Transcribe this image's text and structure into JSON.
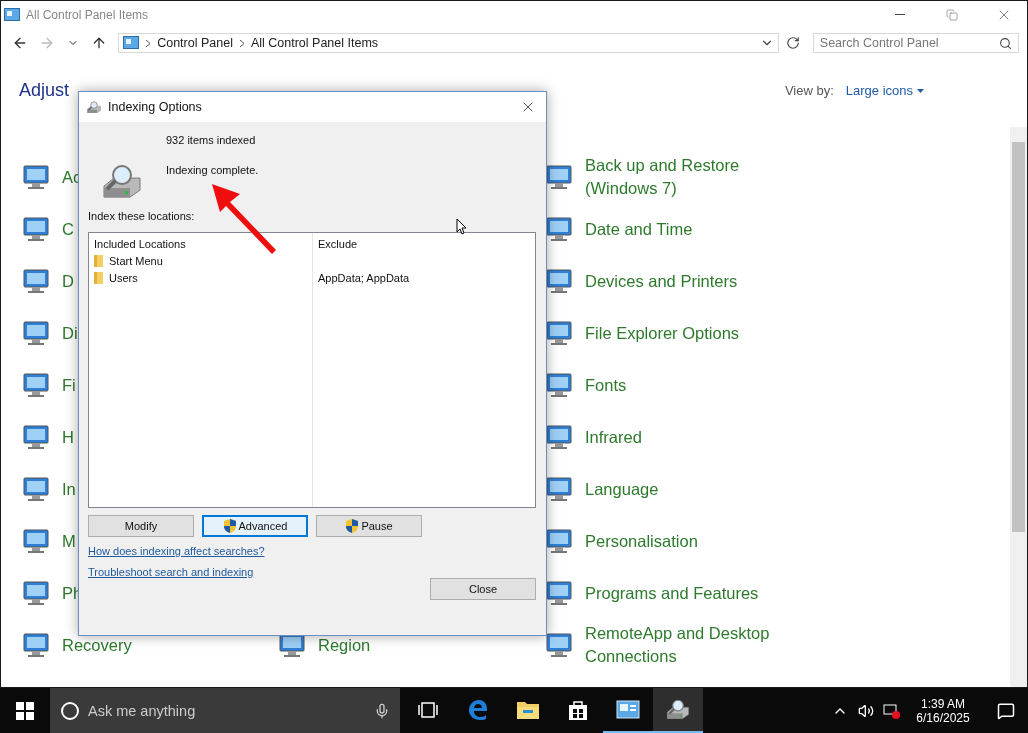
{
  "window": {
    "title": "All Control Panel Items"
  },
  "nav": [
    {
      "kind": "back",
      "disabled": false
    },
    {
      "kind": "forward",
      "disabled": true
    },
    {
      "kind": "recent",
      "disabled": false
    },
    {
      "kind": "up",
      "disabled": false
    }
  ],
  "address": {
    "crumbs": [
      "Control Panel",
      "All Control Panel Items"
    ]
  },
  "search": {
    "placeholder": "Search Control Panel"
  },
  "heading": "Adjust",
  "view_by": {
    "label": "View by:",
    "value": "Large icons"
  },
  "rows": [
    {
      "left": "Ac",
      "right": "Back up and Restore (Windows 7)"
    },
    {
      "left": "C",
      "right": "Date and Time"
    },
    {
      "left": "D",
      "right": "Devices and Printers"
    },
    {
      "left": "Di",
      "right": "File Explorer Options"
    },
    {
      "left": "Fi",
      "right": "Fonts"
    },
    {
      "left": "H",
      "right": "Infrared"
    },
    {
      "left": "In",
      "right": "Language"
    },
    {
      "left": "M",
      "right": "Personalisation"
    },
    {
      "left": "Ph",
      "right": "Programs and Features"
    },
    {
      "left": "Recovery",
      "middle": "Region",
      "right": "RemoteApp and Desktop Connections"
    }
  ],
  "dialog": {
    "title": "Indexing Options",
    "count": "932 items indexed",
    "status": "Indexing complete.",
    "locations_label": "Index these locations:",
    "columns": [
      "Included Locations",
      "Exclude"
    ],
    "locations": [
      {
        "name": "Start Menu"
      },
      {
        "name": "Users",
        "exclude": "AppData; AppData"
      }
    ],
    "buttons": [
      {
        "label": "Modify",
        "shield": false,
        "focused": false
      },
      {
        "label": "Advanced",
        "shield": true,
        "focused": true
      },
      {
        "label": "Pause",
        "shield": true,
        "focused": false
      }
    ],
    "links": [
      "How does indexing affect searches?",
      "Troubleshoot search and indexing"
    ],
    "close": "Close"
  },
  "taskbar": {
    "search_placeholder": "Ask me anything",
    "apps": [
      {
        "kind": "taskview",
        "running": false,
        "selected": false
      },
      {
        "kind": "edge",
        "running": false,
        "selected": false
      },
      {
        "kind": "explorer",
        "running": false,
        "selected": false
      },
      {
        "kind": "store",
        "running": false,
        "selected": false
      },
      {
        "kind": "controlpanel",
        "running": true,
        "selected": false
      },
      {
        "kind": "indexing",
        "running": true,
        "selected": true
      }
    ],
    "time": "1:39 AM",
    "date": "6/16/2025"
  }
}
